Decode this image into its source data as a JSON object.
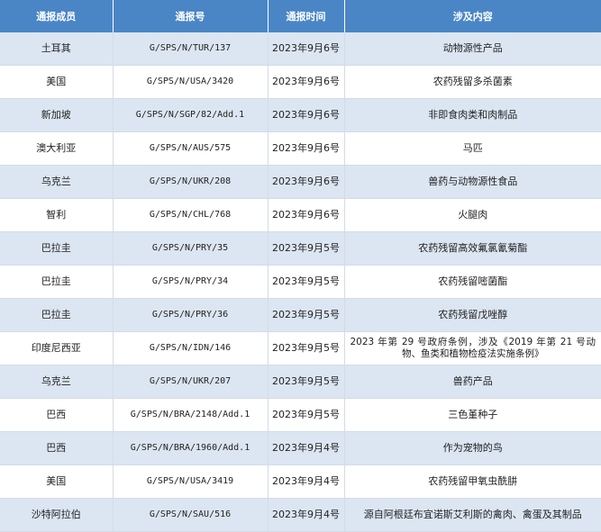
{
  "table": {
    "headers": [
      "通报成员",
      "通报号",
      "通报时间",
      "涉及内容"
    ],
    "rows": [
      {
        "member": "土耳其",
        "code": "G/SPS/N/TUR/137",
        "date": "2023年9月6号",
        "content": "动物源性产品"
      },
      {
        "member": "美国",
        "code": "G/SPS/N/USA/3420",
        "date": "2023年9月6号",
        "content": "农药残留多杀菌素"
      },
      {
        "member": "新加坡",
        "code": "G/SPS/N/SGP/82/Add.1",
        "date": "2023年9月6号",
        "content": "非即食肉类和肉制品"
      },
      {
        "member": "澳大利亚",
        "code": "G/SPS/N/AUS/575",
        "date": "2023年9月6号",
        "content": "马匹"
      },
      {
        "member": "乌克兰",
        "code": "G/SPS/N/UKR/208",
        "date": "2023年9月6号",
        "content": "兽药与动物源性食品"
      },
      {
        "member": "智利",
        "code": "G/SPS/N/CHL/768",
        "date": "2023年9月6号",
        "content": "火腿肉"
      },
      {
        "member": "巴拉圭",
        "code": "G/SPS/N/PRY/35",
        "date": "2023年9月5号",
        "content": "农药残留高效氟氯氰菊酯"
      },
      {
        "member": "巴拉圭",
        "code": "G/SPS/N/PRY/34",
        "date": "2023年9月5号",
        "content": "农药残留嘧菌酯"
      },
      {
        "member": "巴拉圭",
        "code": "G/SPS/N/PRY/36",
        "date": "2023年9月5号",
        "content": "农药残留戊唑醇"
      },
      {
        "member": "印度尼西亚",
        "code": "G/SPS/N/IDN/146",
        "date": "2023年9月5号",
        "content": "2023 年第 29 号政府条例，涉及《2019 年第 21 号动物、鱼类和植物检疫法实施条例》"
      },
      {
        "member": "乌克兰",
        "code": "G/SPS/N/UKR/207",
        "date": "2023年9月5号",
        "content": "兽药产品"
      },
      {
        "member": "巴西",
        "code": "G/SPS/N/BRA/2148/Add.1",
        "date": "2023年9月5号",
        "content": "三色堇种子"
      },
      {
        "member": "巴西",
        "code": "G/SPS/N/BRA/1960/Add.1",
        "date": "2023年9月4号",
        "content": "作为宠物的鸟"
      },
      {
        "member": "美国",
        "code": "G/SPS/N/USA/3419",
        "date": "2023年9月4号",
        "content": "农药残留甲氧虫酰肼"
      },
      {
        "member": "沙特阿拉伯",
        "code": "G/SPS/N/SAU/516",
        "date": "2023年9月4号",
        "content": "源自阿根廷布宜诺斯艾利斯的禽肉、禽蛋及其制品"
      }
    ]
  }
}
